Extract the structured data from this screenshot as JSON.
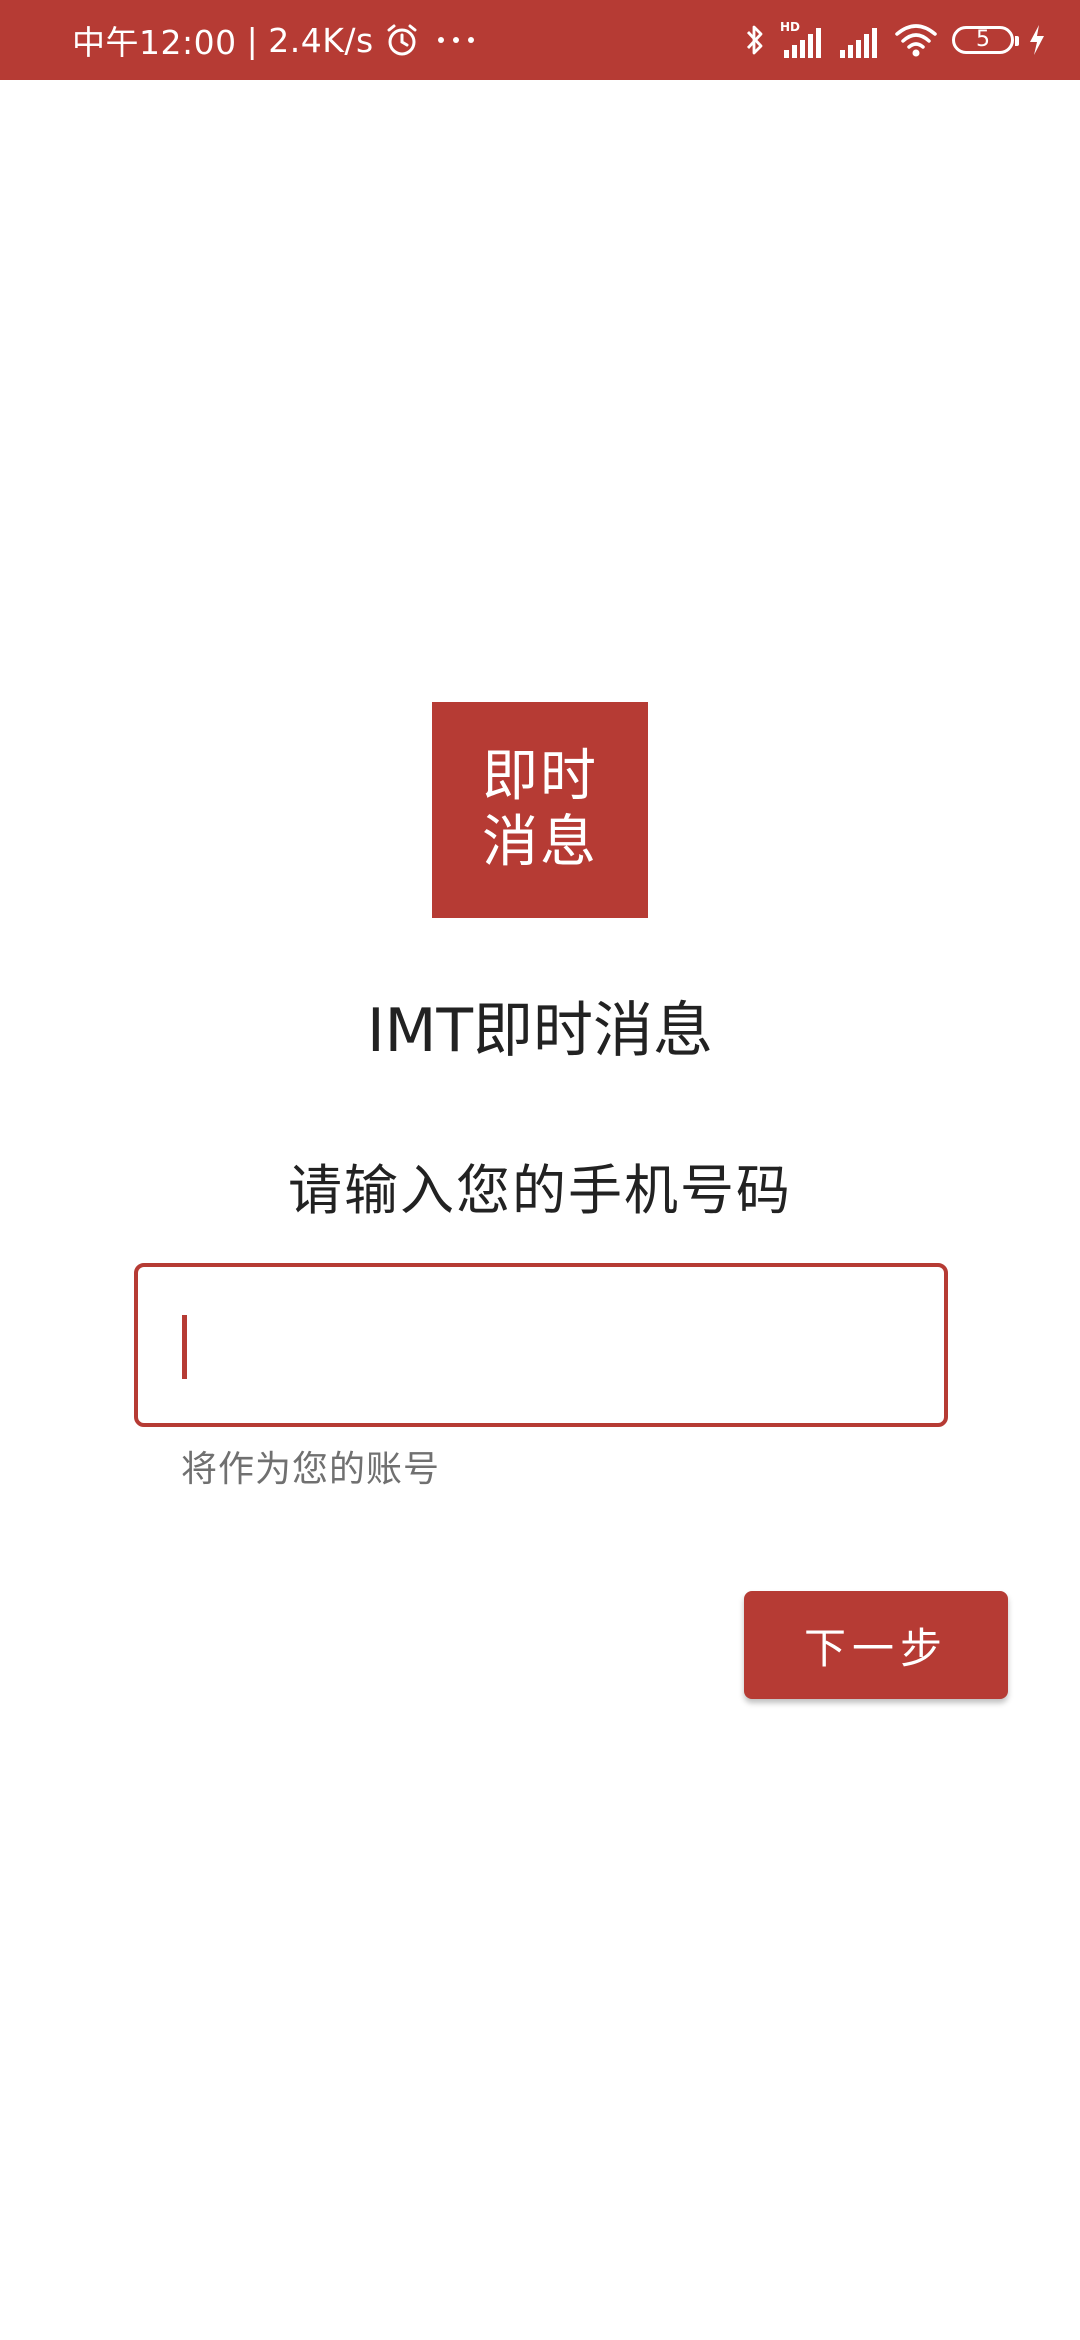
{
  "status_bar": {
    "time": "中午12:00",
    "separator": "|",
    "speed": "2.4K/s",
    "icons": [
      "alarm-icon",
      "more-dots-icon",
      "bluetooth-icon",
      "hd-signal-icon",
      "signal-icon",
      "wifi-icon",
      "battery-icon",
      "charging-icon"
    ],
    "network_tag": "HD",
    "battery_level": "5",
    "background": "#b63b34"
  },
  "logo": {
    "text": "即时消息"
  },
  "app_title": "IMT即时消息",
  "prompt": "请输入您的手机号码",
  "phone_input": {
    "value": "",
    "placeholder": ""
  },
  "helper_text": "将作为您的账号",
  "next_button": {
    "label": "下一步"
  },
  "colors": {
    "accent": "#b63b34",
    "text_primary": "#222222",
    "text_secondary": "#707070",
    "background": "#ffffff"
  }
}
